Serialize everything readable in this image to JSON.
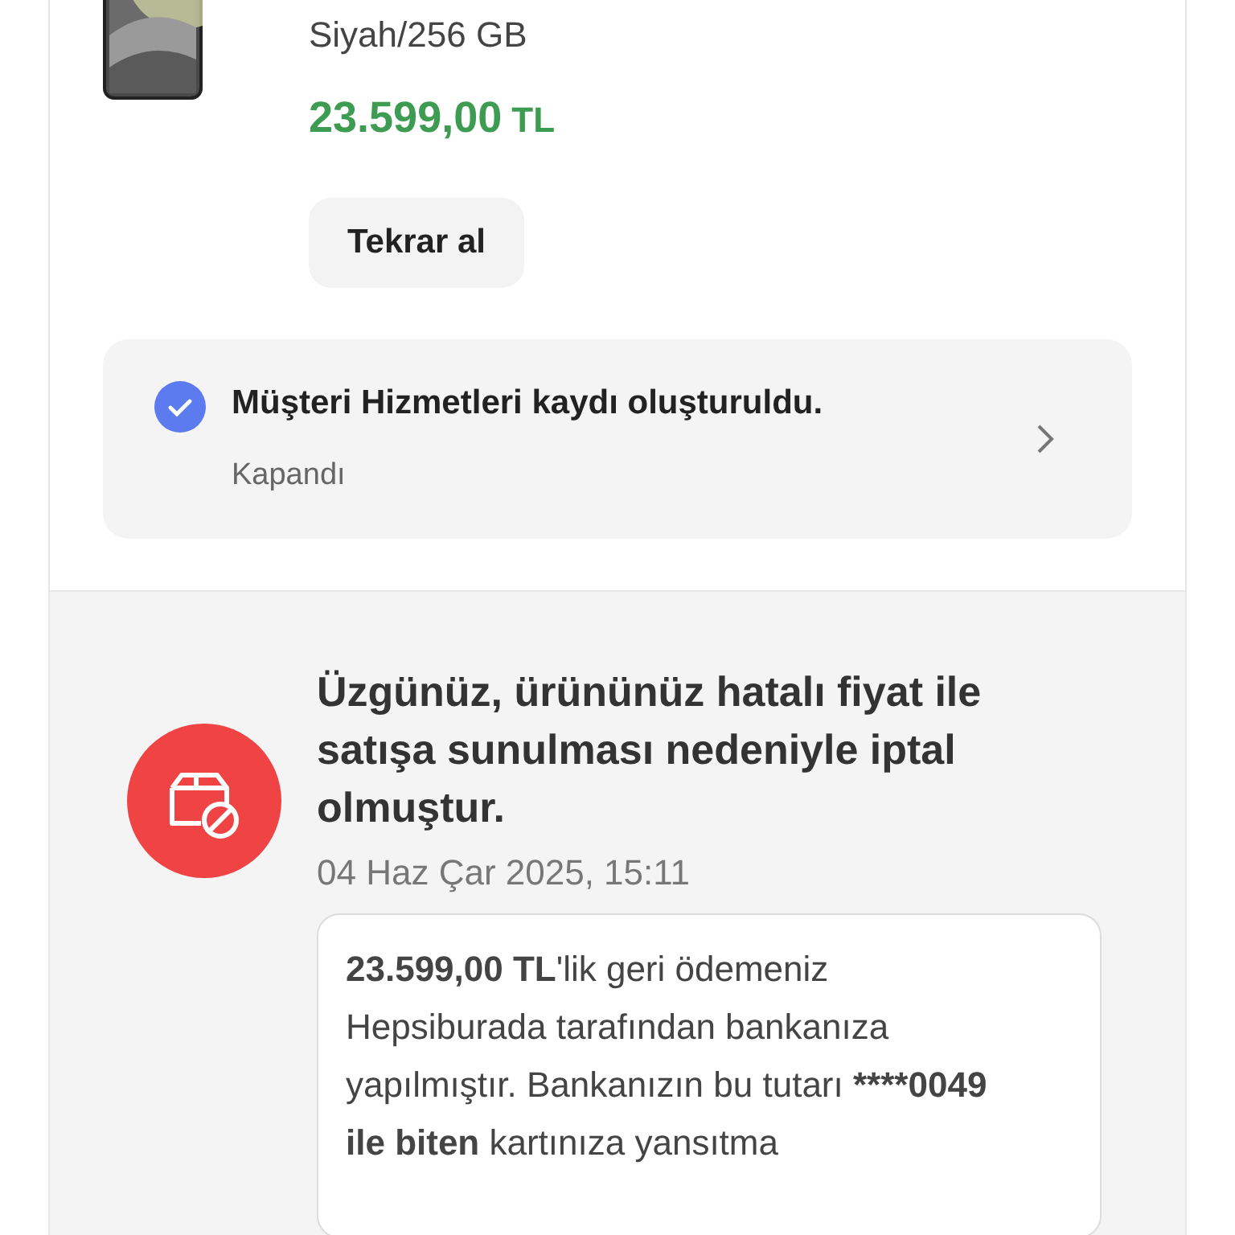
{
  "product": {
    "variant": "Siyah/256 GB",
    "price": "23.599,00",
    "currency": "TL",
    "buttons": [
      {
        "label": "Tekrar al"
      }
    ]
  },
  "support_record": {
    "title": "Müşteri Hizmetleri kaydı oluşturuldu.",
    "status": "Kapandı"
  },
  "cancellation": {
    "title": "Üzgünüz, ürününüz hatalı fiyat ile satışa sunulması nedeniyle iptal olmuştur.",
    "date": "04 Haz Çar 2025, 15:11",
    "refund_message": [
      {
        "text": "23.599,00 TL",
        "bold": true
      },
      {
        "text": "'lik geri ödemeniz Hepsiburada tarafından bankanıza yapılmıştır. Bankanızın bu tutarı ",
        "bold": false
      },
      {
        "text": "****0049 ile biten",
        "bold": true
      },
      {
        "text": " kartınıza yansıtma",
        "bold": false
      }
    ]
  }
}
